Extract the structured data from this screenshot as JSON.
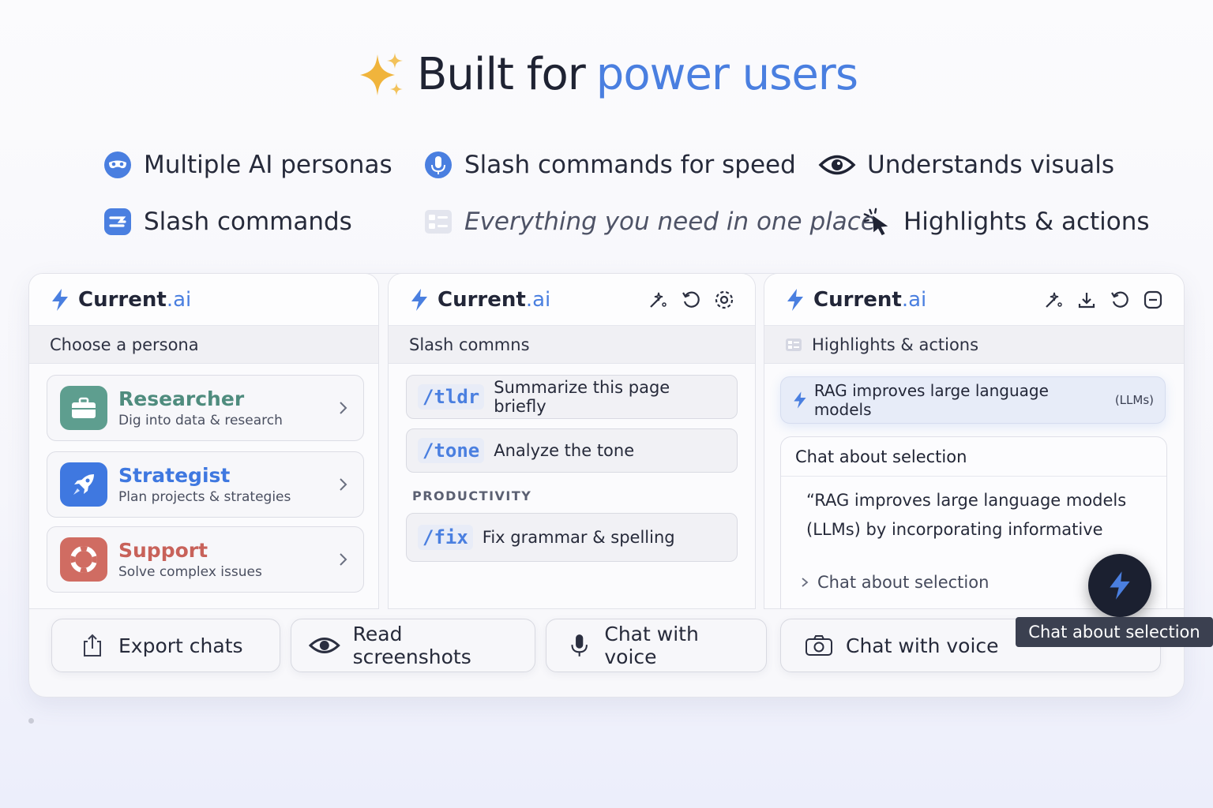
{
  "hero": {
    "title_part1": "Built for",
    "title_part2": "power users"
  },
  "features": [
    {
      "label": "Multiple AI personas",
      "icon": "mask-icon"
    },
    {
      "label": "Slash commands for speed",
      "icon": "microphone-icon"
    },
    {
      "label": "Understands visuals",
      "icon": "eye-icon"
    },
    {
      "label": "Slash commands",
      "icon": "slash-icon"
    },
    {
      "label": "Everything you need in one place",
      "icon": "layout-icon"
    },
    {
      "label": "Highlights & actions",
      "icon": "cursor-click-icon"
    }
  ],
  "brand": {
    "name": "Current",
    "suffix": ".ai"
  },
  "panel1": {
    "subheader": "Choose a persona",
    "personas": [
      {
        "name": "Researcher",
        "desc": "Dig into data & research",
        "color": "#5e9e8f",
        "icon": "briefcase-icon"
      },
      {
        "name": "Strategist",
        "desc": "Plan projects & strategies",
        "color": "#3f78e0",
        "icon": "rocket-icon"
      },
      {
        "name": "Support",
        "desc": "Solve complex issues",
        "color": "#c8625a",
        "icon": "lifebuoy-icon"
      }
    ]
  },
  "panel2": {
    "subheader": "Slash commns",
    "commands": [
      {
        "cmd": "/tldr",
        "desc": "Summarize this page briefly"
      },
      {
        "cmd": "/tone",
        "desc": "Analyze the tone"
      }
    ],
    "section": "PRODUCTIVITY",
    "commands2": [
      {
        "cmd": "/fix",
        "desc": "Fix grammar & spelling"
      }
    ]
  },
  "panel3": {
    "subheader": "Highlights & actions",
    "highlight": "RAG improves large language models",
    "highlight_small": "(LLMs)",
    "card_title": "Chat about selection",
    "quote_line1": "“RAG improves large language models",
    "quote_line2": "(LLMs) by incorporating informative",
    "link": "Chat about selection",
    "tooltip": "Chat about selection"
  },
  "buttons": [
    {
      "label": "Export chats",
      "icon": "share-icon"
    },
    {
      "label": "Read screenshots",
      "icon": "eye-icon"
    },
    {
      "label": "Chat with voice",
      "icon": "microphone-icon"
    },
    {
      "label": "Chat with voice",
      "icon": "camera-icon"
    }
  ],
  "colors": {
    "accent": "#4a7fe0",
    "sparkle": "#f0b43c",
    "dark": "#1b2030"
  }
}
